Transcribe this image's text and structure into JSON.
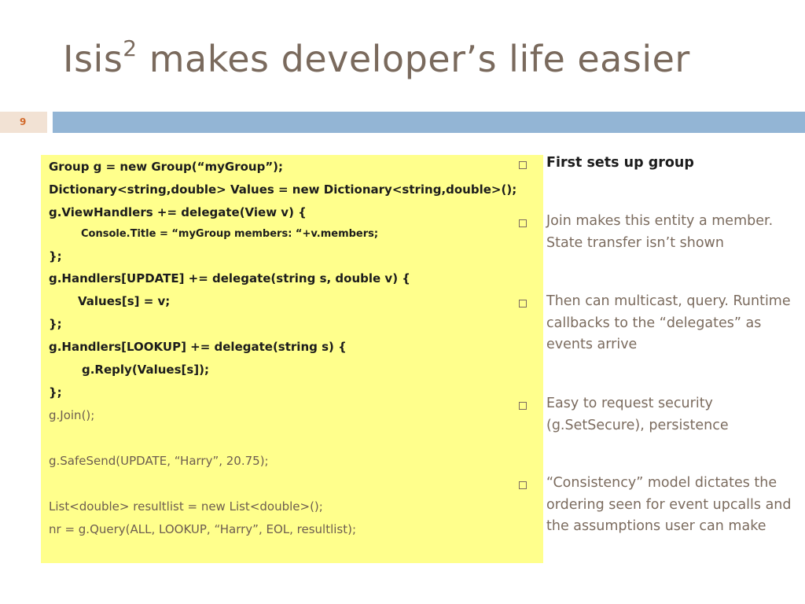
{
  "slide": {
    "title_main": "Isis",
    "title_sup": "2",
    "title_rest": " makes developer’s life easier",
    "page_number": "9"
  },
  "code": [
    "Group g = new Group(“myGroup”);",
    "Dictionary<string,double> Values = new Dictionary<string,double>();",
    "g.ViewHandlers += delegate(View v) {",
    "Console.Title = “myGroup members: “+v.members;",
    "};",
    "g.Handlers[UPDATE] += delegate(string s, double v) {",
    "Values[s] = v;",
    "};",
    "g.Handlers[LOOKUP] += delegate(string s) {",
    "g.Reply(Values[s]);",
    "};",
    "g.Join();",
    "g.SafeSend(UPDATE, “Harry”, 20.75);",
    "List<double> resultlist = new List<double>();",
    "nr = g.Query(ALL, LOOKUP, “Harry”, EOL, resultlist);"
  ],
  "bullets": [
    "First sets up group",
    "Join makes this entity a member. State transfer isn’t shown",
    "Then can multicast, query. Runtime callbacks to the “delegates” as events arrive",
    "Easy to request security (g.SetSecure), persistence",
    "“Consistency” model dictates the ordering seen for event upcalls and the assumptions user can make"
  ]
}
